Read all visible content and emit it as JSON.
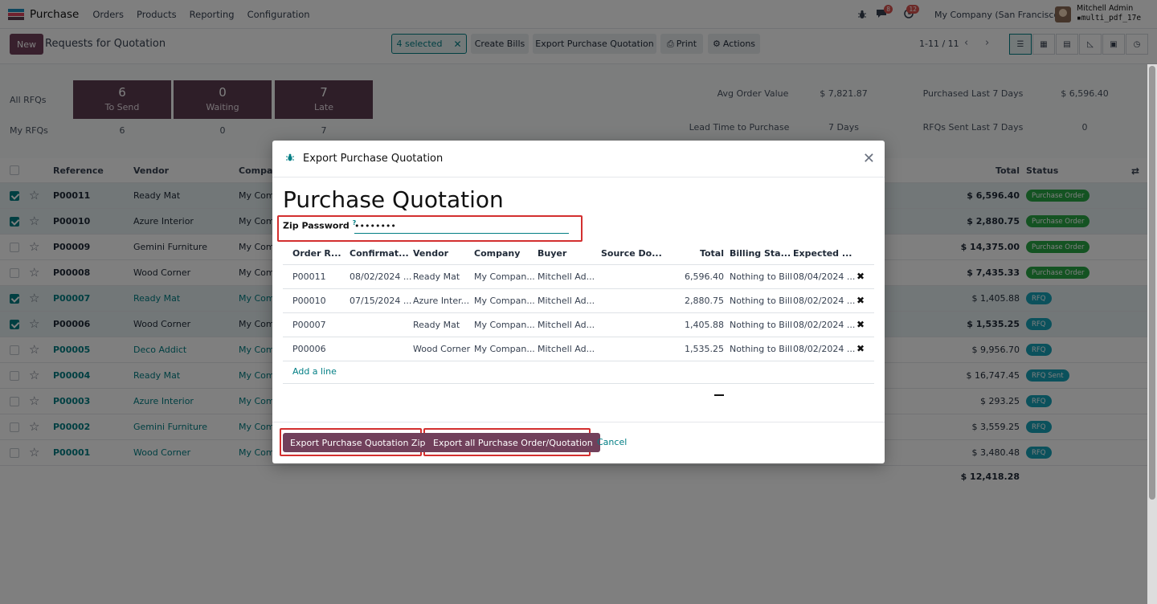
{
  "topbar": {
    "app_name": "Purchase",
    "menu": [
      "Orders",
      "Products",
      "Reporting",
      "Configuration"
    ],
    "chat_count": "8",
    "activity_count": "12",
    "company": "My Company (San Francisco)",
    "user_name": "Mitchell Admin",
    "db_name": "multi_pdf_17e"
  },
  "control": {
    "new_label": "New",
    "breadcrumb": "Requests for Quotation",
    "selected_label": "4 selected",
    "create_bills": "Create Bills",
    "export_pq": "Export Purchase Quotation",
    "print": "Print",
    "actions": "Actions",
    "pager": "1-11 / 11"
  },
  "dashboard": {
    "all_rfqs": "All RFQs",
    "my_rfqs": "My RFQs",
    "tiles": [
      {
        "count": "6",
        "label": "To Send",
        "my": "6"
      },
      {
        "count": "0",
        "label": "Waiting",
        "my": "0"
      },
      {
        "count": "7",
        "label": "Late",
        "my": "7"
      }
    ],
    "avg_order_label": "Avg Order Value",
    "avg_order_value": "$ 7,821.87",
    "purchased_label": "Purchased Last 7 Days",
    "purchased_value": "$ 6,596.40",
    "lead_label": "Lead Time to Purchase",
    "lead_value": "7 Days",
    "sent_label": "RFQs Sent Last 7 Days",
    "sent_value": "0"
  },
  "table": {
    "headers": {
      "reference": "Reference",
      "vendor": "Vendor",
      "company": "Company",
      "total": "Total",
      "status": "Status"
    },
    "rows": [
      {
        "ref": "P00011",
        "vendor": "Ready Mat",
        "company": "My Comp",
        "total": "$ 6,596.40",
        "status": "Purchase Order",
        "selected": true
      },
      {
        "ref": "P00010",
        "vendor": "Azure Interior",
        "company": "My Comp",
        "total": "$ 2,880.75",
        "status": "Purchase Order",
        "selected": true
      },
      {
        "ref": "P00009",
        "vendor": "Gemini Furniture",
        "company": "My Comp",
        "total": "$ 14,375.00",
        "status": "Purchase Order",
        "selected": false
      },
      {
        "ref": "P00008",
        "vendor": "Wood Corner",
        "company": "My Comp",
        "total": "$ 7,435.33",
        "status": "Purchase Order",
        "selected": false
      },
      {
        "ref": "P00007",
        "vendor": "Ready Mat",
        "company": "My Comp",
        "total": "$ 1,405.88",
        "status": "RFQ",
        "selected": true
      },
      {
        "ref": "P00006",
        "vendor": "Wood Corner",
        "company": "My Comp",
        "total": "$ 1,535.25",
        "status": "RFQ",
        "selected": true
      },
      {
        "ref": "P00005",
        "vendor": "Deco Addict",
        "company": "My Comp",
        "total": "$ 9,956.70",
        "status": "RFQ",
        "selected": false
      },
      {
        "ref": "P00004",
        "vendor": "Ready Mat",
        "company": "My Comp",
        "total": "$ 16,747.45",
        "status": "RFQ Sent",
        "selected": false
      },
      {
        "ref": "P00003",
        "vendor": "Azure Interior",
        "company": "My Comp",
        "total": "$ 293.25",
        "status": "RFQ",
        "selected": false
      },
      {
        "ref": "P00002",
        "vendor": "Gemini Furniture",
        "company": "My Comp",
        "total": "$ 3,559.25",
        "status": "RFQ",
        "selected": false
      },
      {
        "ref": "P00001",
        "vendor": "Wood Corner",
        "company": "My Comp",
        "total": "$ 3,480.48",
        "status": "RFQ",
        "selected": false
      }
    ],
    "grand_total": "$ 12,418.28"
  },
  "modal": {
    "title": "Export Purchase Quotation",
    "heading": "Purchase Quotation",
    "zip_label": "Zip Password",
    "zip_help": "?",
    "zip_value": "••••••••",
    "columns": [
      "Order R...",
      "Confirmat...",
      "Vendor",
      "Company",
      "Buyer",
      "Source Do...",
      "Total",
      "Billing Sta...",
      "Expected ..."
    ],
    "lines": [
      {
        "ref": "P00011",
        "confirm": "08/02/2024 ...",
        "vendor": "Ready Mat",
        "company": "My Compan...",
        "buyer": "Mitchell Ad...",
        "source": "",
        "total": "6,596.40",
        "billing": "Nothing to Bill",
        "expected": "08/04/2024 ..."
      },
      {
        "ref": "P00010",
        "confirm": "07/15/2024 ...",
        "vendor": "Azure Inter...",
        "company": "My Compan...",
        "buyer": "Mitchell Ad...",
        "source": "",
        "total": "2,880.75",
        "billing": "Nothing to Bill",
        "expected": "08/02/2024 ..."
      },
      {
        "ref": "P00007",
        "confirm": "",
        "vendor": "Ready Mat",
        "company": "My Compan...",
        "buyer": "Mitchell Ad...",
        "source": "",
        "total": "1,405.88",
        "billing": "Nothing to Bill",
        "expected": "08/02/2024 ..."
      },
      {
        "ref": "P00006",
        "confirm": "",
        "vendor": "Wood Corner",
        "company": "My Compan...",
        "buyer": "Mitchell Ad...",
        "source": "",
        "total": "1,535.25",
        "billing": "Nothing to Bill",
        "expected": "08/02/2024 ..."
      }
    ],
    "add_line": "Add a line",
    "sum_dash": "—",
    "btn_zip": "Export Purchase Quotation Zip",
    "btn_all": "Export all Purchase Order/Quotation",
    "btn_cancel": "Cancel"
  }
}
